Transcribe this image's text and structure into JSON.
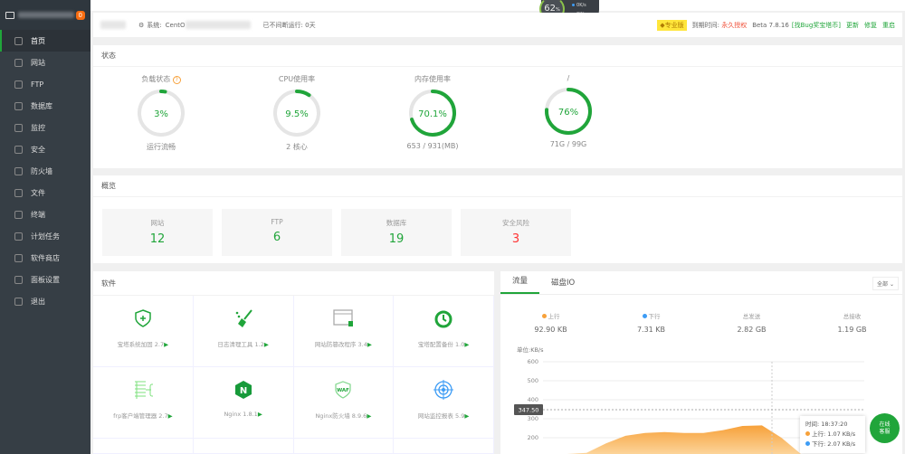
{
  "sidebar": {
    "badge": "0",
    "items": [
      "首页",
      "网站",
      "FTP",
      "数据库",
      "监控",
      "安全",
      "防火墙",
      "文件",
      "终端",
      "计划任务",
      "软件商店",
      "面板设置",
      "退出"
    ]
  },
  "float": {
    "pct": "62",
    "unit": "%",
    "up": "0",
    "down": "0",
    "rate_unit": "K/s"
  },
  "topbar": {
    "sys_label": "系统:",
    "sys_value": "CentO",
    "uptime": "已不间断运行: 0天",
    "edition": "专业版",
    "expire_label": "到期时间:",
    "expire_value": "永久授权",
    "version": "Beta 7.8.16",
    "bug": "[找Bug奖宝塔币]",
    "update": "更新",
    "repair": "修复",
    "restart": "重启"
  },
  "status": {
    "title": "状态",
    "gauges": [
      {
        "label": "负载状态",
        "value": "3%",
        "sub": "运行流畅",
        "pct": 3
      },
      {
        "label": "CPU使用率",
        "value": "9.5%",
        "sub": "2 核心",
        "pct": 9.5
      },
      {
        "label": "内存使用率",
        "value": "70.1%",
        "sub": "653 / 931(MB)",
        "pct": 70.1
      },
      {
        "label": "/",
        "value": "76%",
        "sub": "71G / 99G",
        "pct": 76
      }
    ]
  },
  "overview": {
    "title": "概览",
    "items": [
      {
        "label": "网站",
        "value": "12"
      },
      {
        "label": "FTP",
        "value": "6"
      },
      {
        "label": "数据库",
        "value": "19"
      },
      {
        "label": "安全风险",
        "value": "3"
      }
    ]
  },
  "software": {
    "title": "软件",
    "items": [
      "宝塔系统加固 2.7",
      "日志清理工具 1.2",
      "网站防篡改程序 3.4",
      "宝塔配置备份 1.0",
      "frp客户端管理器 2.7",
      "Nginx 1.8.1",
      "Nginx防火墙 8.9.6",
      "网站监控报表 5.9"
    ],
    "icon_text": {
      "nginx": "N",
      "waf": "WAF"
    }
  },
  "traffic": {
    "tabs": [
      "流量",
      "磁盘IO"
    ],
    "select": "全部",
    "stats": [
      {
        "label": "上行",
        "value": "92.90 KB"
      },
      {
        "label": "下行",
        "value": "7.31 KB"
      },
      {
        "label": "总发送",
        "value": "2.82 GB"
      },
      {
        "label": "总接收",
        "value": "1.19 GB"
      }
    ],
    "tooltip": {
      "time": "时间: 18:37:20",
      "up": "上行: 1.07 KB/s",
      "down": "下行: 2.07 KB/s"
    },
    "chat": [
      "在线",
      "客服"
    ]
  },
  "chart_data": {
    "type": "area",
    "unit": "单位:KB/s",
    "ylim": [
      0,
      600
    ],
    "yticks": [
      600,
      500,
      400,
      300,
      200
    ],
    "crosshair_value": "347.50",
    "series": [
      {
        "name": "上行",
        "color": "#f7a13a",
        "values": [
          0,
          60,
          120,
          170,
          210,
          225,
          230,
          225,
          225,
          240,
          262,
          265,
          200,
          0
        ]
      }
    ]
  },
  "colors": {
    "accent": "#20a53a",
    "danger": "#ff3333",
    "up": "#f7a13a",
    "down": "#3d9cf5"
  }
}
